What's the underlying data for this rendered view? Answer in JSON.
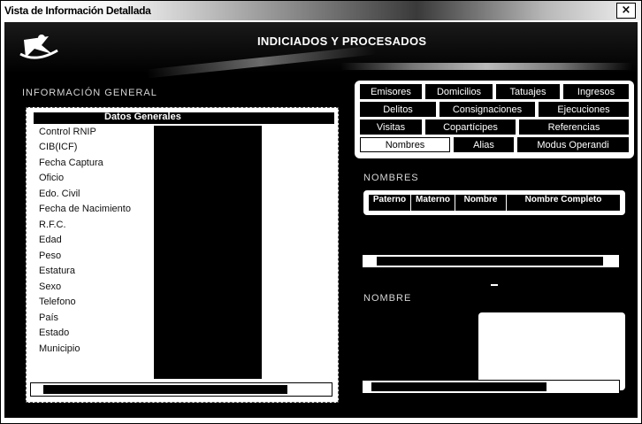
{
  "window": {
    "title": "Vista de Información Detallada",
    "close_label": "×"
  },
  "header": {
    "app_title": "INDICIADOS Y PROCESADOS"
  },
  "general_info": {
    "section_label": "INFORMACIÓN GENERAL",
    "table_title": "Datos Generales",
    "fields": [
      "Control RNIP",
      "CIB(ICF)",
      "Fecha Captura",
      "Oficio",
      "Edo. Civil",
      "Fecha de Nacimiento",
      "R.F.C.",
      "Edad",
      "Peso",
      "Estatura",
      "Sexo",
      "Telefono",
      "País",
      "Estado",
      "Municipio"
    ]
  },
  "tabs": {
    "row1": [
      "Emisores",
      "Domicilios",
      "Tatuajes",
      "Ingresos"
    ],
    "row2": [
      "Delitos",
      "Consignaciones",
      "Ejecuciones"
    ],
    "row3": [
      "Visitas",
      "Copartícipes",
      "Referencias"
    ],
    "row4": [
      "Nombres",
      "Alias",
      "Modus Operandi"
    ],
    "active": "Nombres"
  },
  "names": {
    "section_label": "NOMBRES",
    "columns": [
      "Paterno",
      "Materno",
      "Nombre",
      "Nombre Completo"
    ],
    "lower_section_label": "NOMBRE"
  },
  "colors": {
    "background": "#000000",
    "panel": "#ffffff",
    "text": "#111111"
  }
}
